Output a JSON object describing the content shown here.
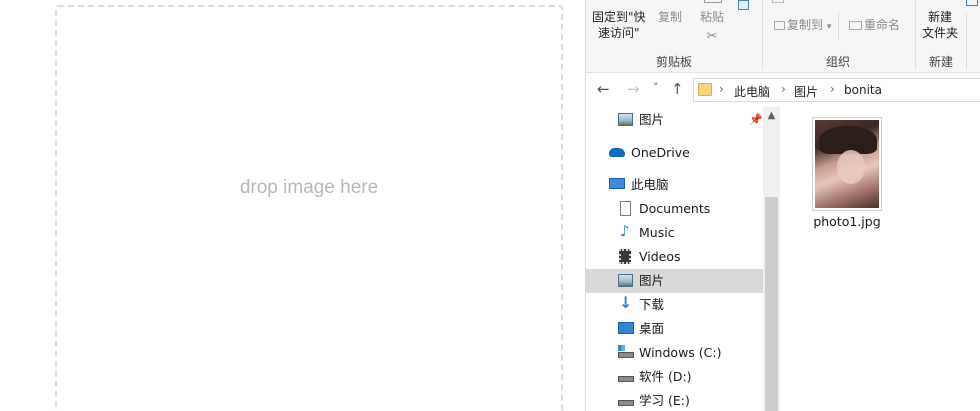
{
  "drop_zone": {
    "text": "drop image here"
  },
  "ribbon": {
    "pin_quick_access": [
      "固定到\"快",
      "速访问\""
    ],
    "copy": "复制",
    "paste": "粘贴",
    "move_to": "复制到",
    "move_to_arrow": "▾",
    "rename": "重命名",
    "new_folder": [
      "新建",
      "文件夹"
    ],
    "groups": {
      "clipboard": "剪贴板",
      "organize": "组织",
      "new": "新建"
    }
  },
  "address_bar": {
    "back": "←",
    "forward": "→",
    "recent": "˅",
    "up": "↑",
    "crumbs": [
      "此电脑",
      "图片",
      "bonita"
    ],
    "separator": "›"
  },
  "nav_pane": {
    "items": [
      {
        "label": "图片",
        "icon": "pictures-icon"
      },
      {
        "label": "OneDrive",
        "icon": "onedrive-icon"
      },
      {
        "label": "此电脑",
        "icon": "this-pc-icon"
      },
      {
        "label": "Documents",
        "icon": "documents-icon"
      },
      {
        "label": "Music",
        "icon": "music-icon"
      },
      {
        "label": "Videos",
        "icon": "videos-icon"
      },
      {
        "label": "图片",
        "icon": "pictures-icon"
      },
      {
        "label": "下载",
        "icon": "downloads-icon"
      },
      {
        "label": "桌面",
        "icon": "desktop-icon"
      },
      {
        "label": "Windows (C:)",
        "icon": "drive-icon"
      },
      {
        "label": "软件 (D:)",
        "icon": "drive-icon"
      },
      {
        "label": "学习 (E:)",
        "icon": "drive-icon"
      }
    ],
    "selected_index": 6
  },
  "content": {
    "files": [
      {
        "name": "photo1.jpg",
        "icon": "photo-thumbnail"
      }
    ]
  },
  "colors": {
    "selected_bg": "#d9d9d9",
    "folder_yellow": "#f9d57a",
    "onedrive_blue": "#0f6cbd"
  }
}
